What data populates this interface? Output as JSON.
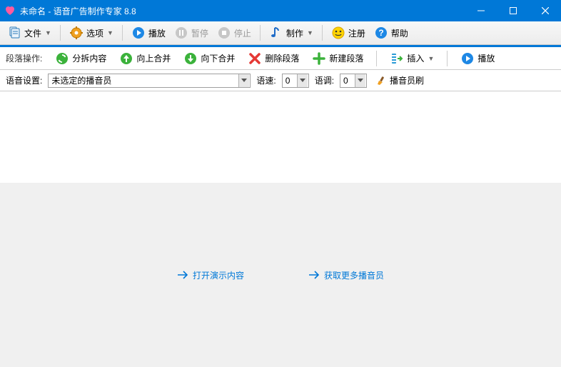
{
  "window": {
    "title": "未命名 - 语音广告制作专家 8.8"
  },
  "menu": {
    "file": "文件",
    "options": "选项",
    "play": "播放",
    "pause": "暂停",
    "stop": "停止",
    "make": "制作",
    "register": "注册",
    "help": "帮助"
  },
  "toolbar": {
    "section_label": "段落操作:",
    "split": "分拆内容",
    "merge_up": "向上合并",
    "merge_down": "向下合并",
    "delete": "删除段落",
    "new": "新建段落",
    "insert": "插入",
    "play": "播放"
  },
  "voice": {
    "settings_label": "语音设置:",
    "announcer_value": "未选定的播音员",
    "speed_label": "语速:",
    "speed_value": "0",
    "tone_label": "语调:",
    "tone_value": "0",
    "brush": "播音员刷"
  },
  "links": {
    "demo": "打开演示内容",
    "more": "获取更多播音员"
  }
}
